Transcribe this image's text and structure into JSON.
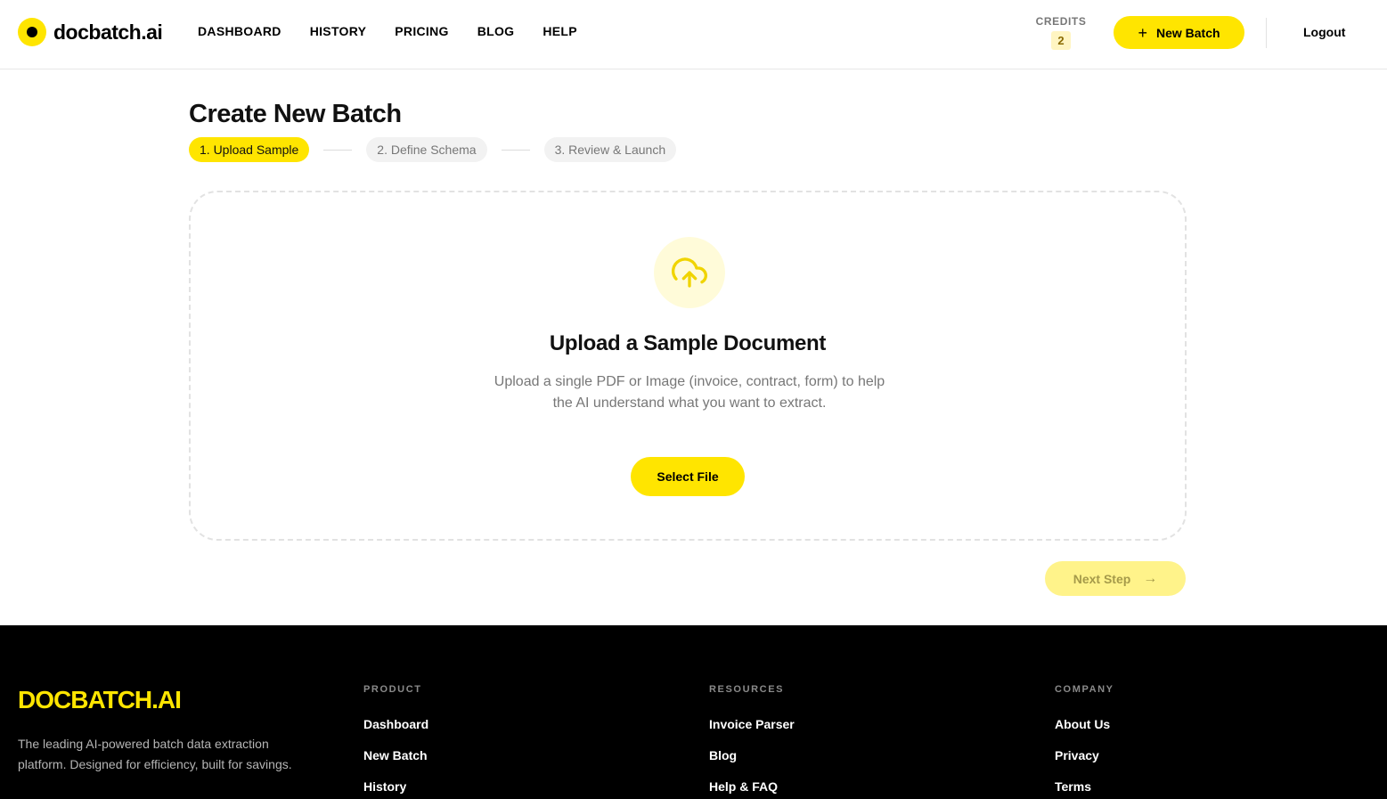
{
  "brand": {
    "name": "docbatch.ai"
  },
  "nav": {
    "items": [
      "DASHBOARD",
      "HISTORY",
      "PRICING",
      "BLOG",
      "HELP"
    ]
  },
  "credits": {
    "label": "CREDITS",
    "value": "2"
  },
  "header": {
    "new_batch_label": "New Batch",
    "logout_label": "Logout"
  },
  "page": {
    "title": "Create New Batch",
    "steps": [
      "1. Upload Sample",
      "2. Define Schema",
      "3. Review & Launch"
    ],
    "active_step": 0
  },
  "upload": {
    "title": "Upload a Sample Document",
    "description": "Upload a single PDF or Image (invoice, contract, form) to help the AI understand what you want to extract.",
    "button_label": "Select File"
  },
  "next_button_label": "Next Step",
  "footer": {
    "brand": "DOCBATCH.AI",
    "tagline": "The leading AI-powered batch data extraction platform. Designed for efficiency, built for savings.",
    "columns": [
      {
        "title": "PRODUCT",
        "links": [
          "Dashboard",
          "New Batch",
          "History"
        ]
      },
      {
        "title": "RESOURCES",
        "links": [
          "Invoice Parser",
          "Blog",
          "Help & FAQ"
        ]
      },
      {
        "title": "COMPANY",
        "links": [
          "About Us",
          "Privacy",
          "Terms"
        ]
      }
    ]
  },
  "colors": {
    "accent": "#ffe500",
    "footer_bg": "#000000"
  }
}
